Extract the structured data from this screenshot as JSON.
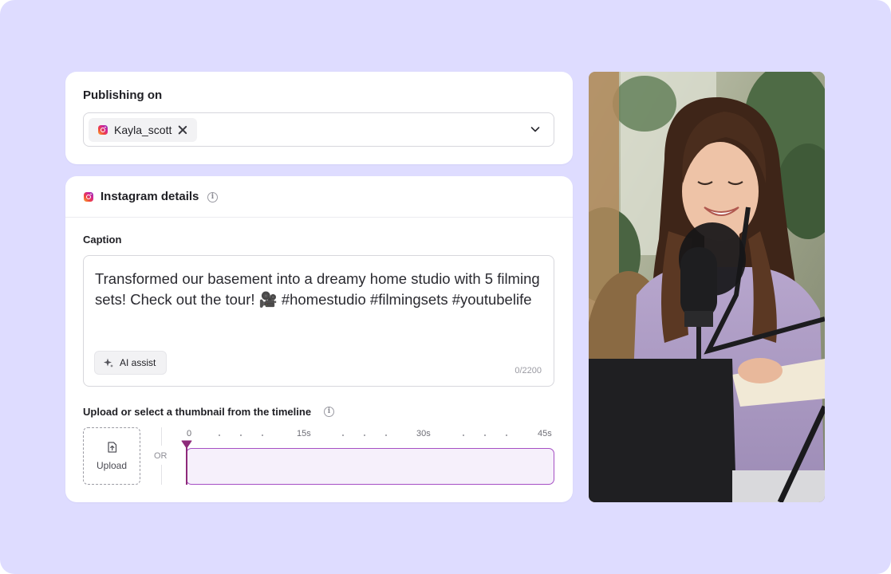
{
  "publishing": {
    "title": "Publishing on",
    "account": "Kayla_scott"
  },
  "instagram": {
    "title": "Instagram details",
    "caption_label": "Caption",
    "caption_text": "Transformed our basement into a dreamy home studio with 5 filming sets! Check out the tour! 🎥 #homestudio #filmingsets #youtubelife",
    "ai_assist_label": "AI assist",
    "char_count": "0/2200",
    "thumbnail_label": "Upload or select a thumbnail from the timeline",
    "upload_label": "Upload",
    "or_label": "OR",
    "timeline_ticks": [
      "0",
      "15s",
      "30s",
      "45s"
    ],
    "playhead_position_seconds": 0
  },
  "colors": {
    "background": "#dedcff",
    "timeline_border": "#a64fc4",
    "timeline_fill": "#f6f0fb",
    "playhead": "#8e2a7a"
  },
  "icons": {
    "account_chip": "instagram-icon",
    "chip_remove": "close-icon",
    "dropdown": "chevron-down-icon",
    "info": "info-icon",
    "ai_assist": "sparkle-icon",
    "upload": "upload-file-icon"
  }
}
